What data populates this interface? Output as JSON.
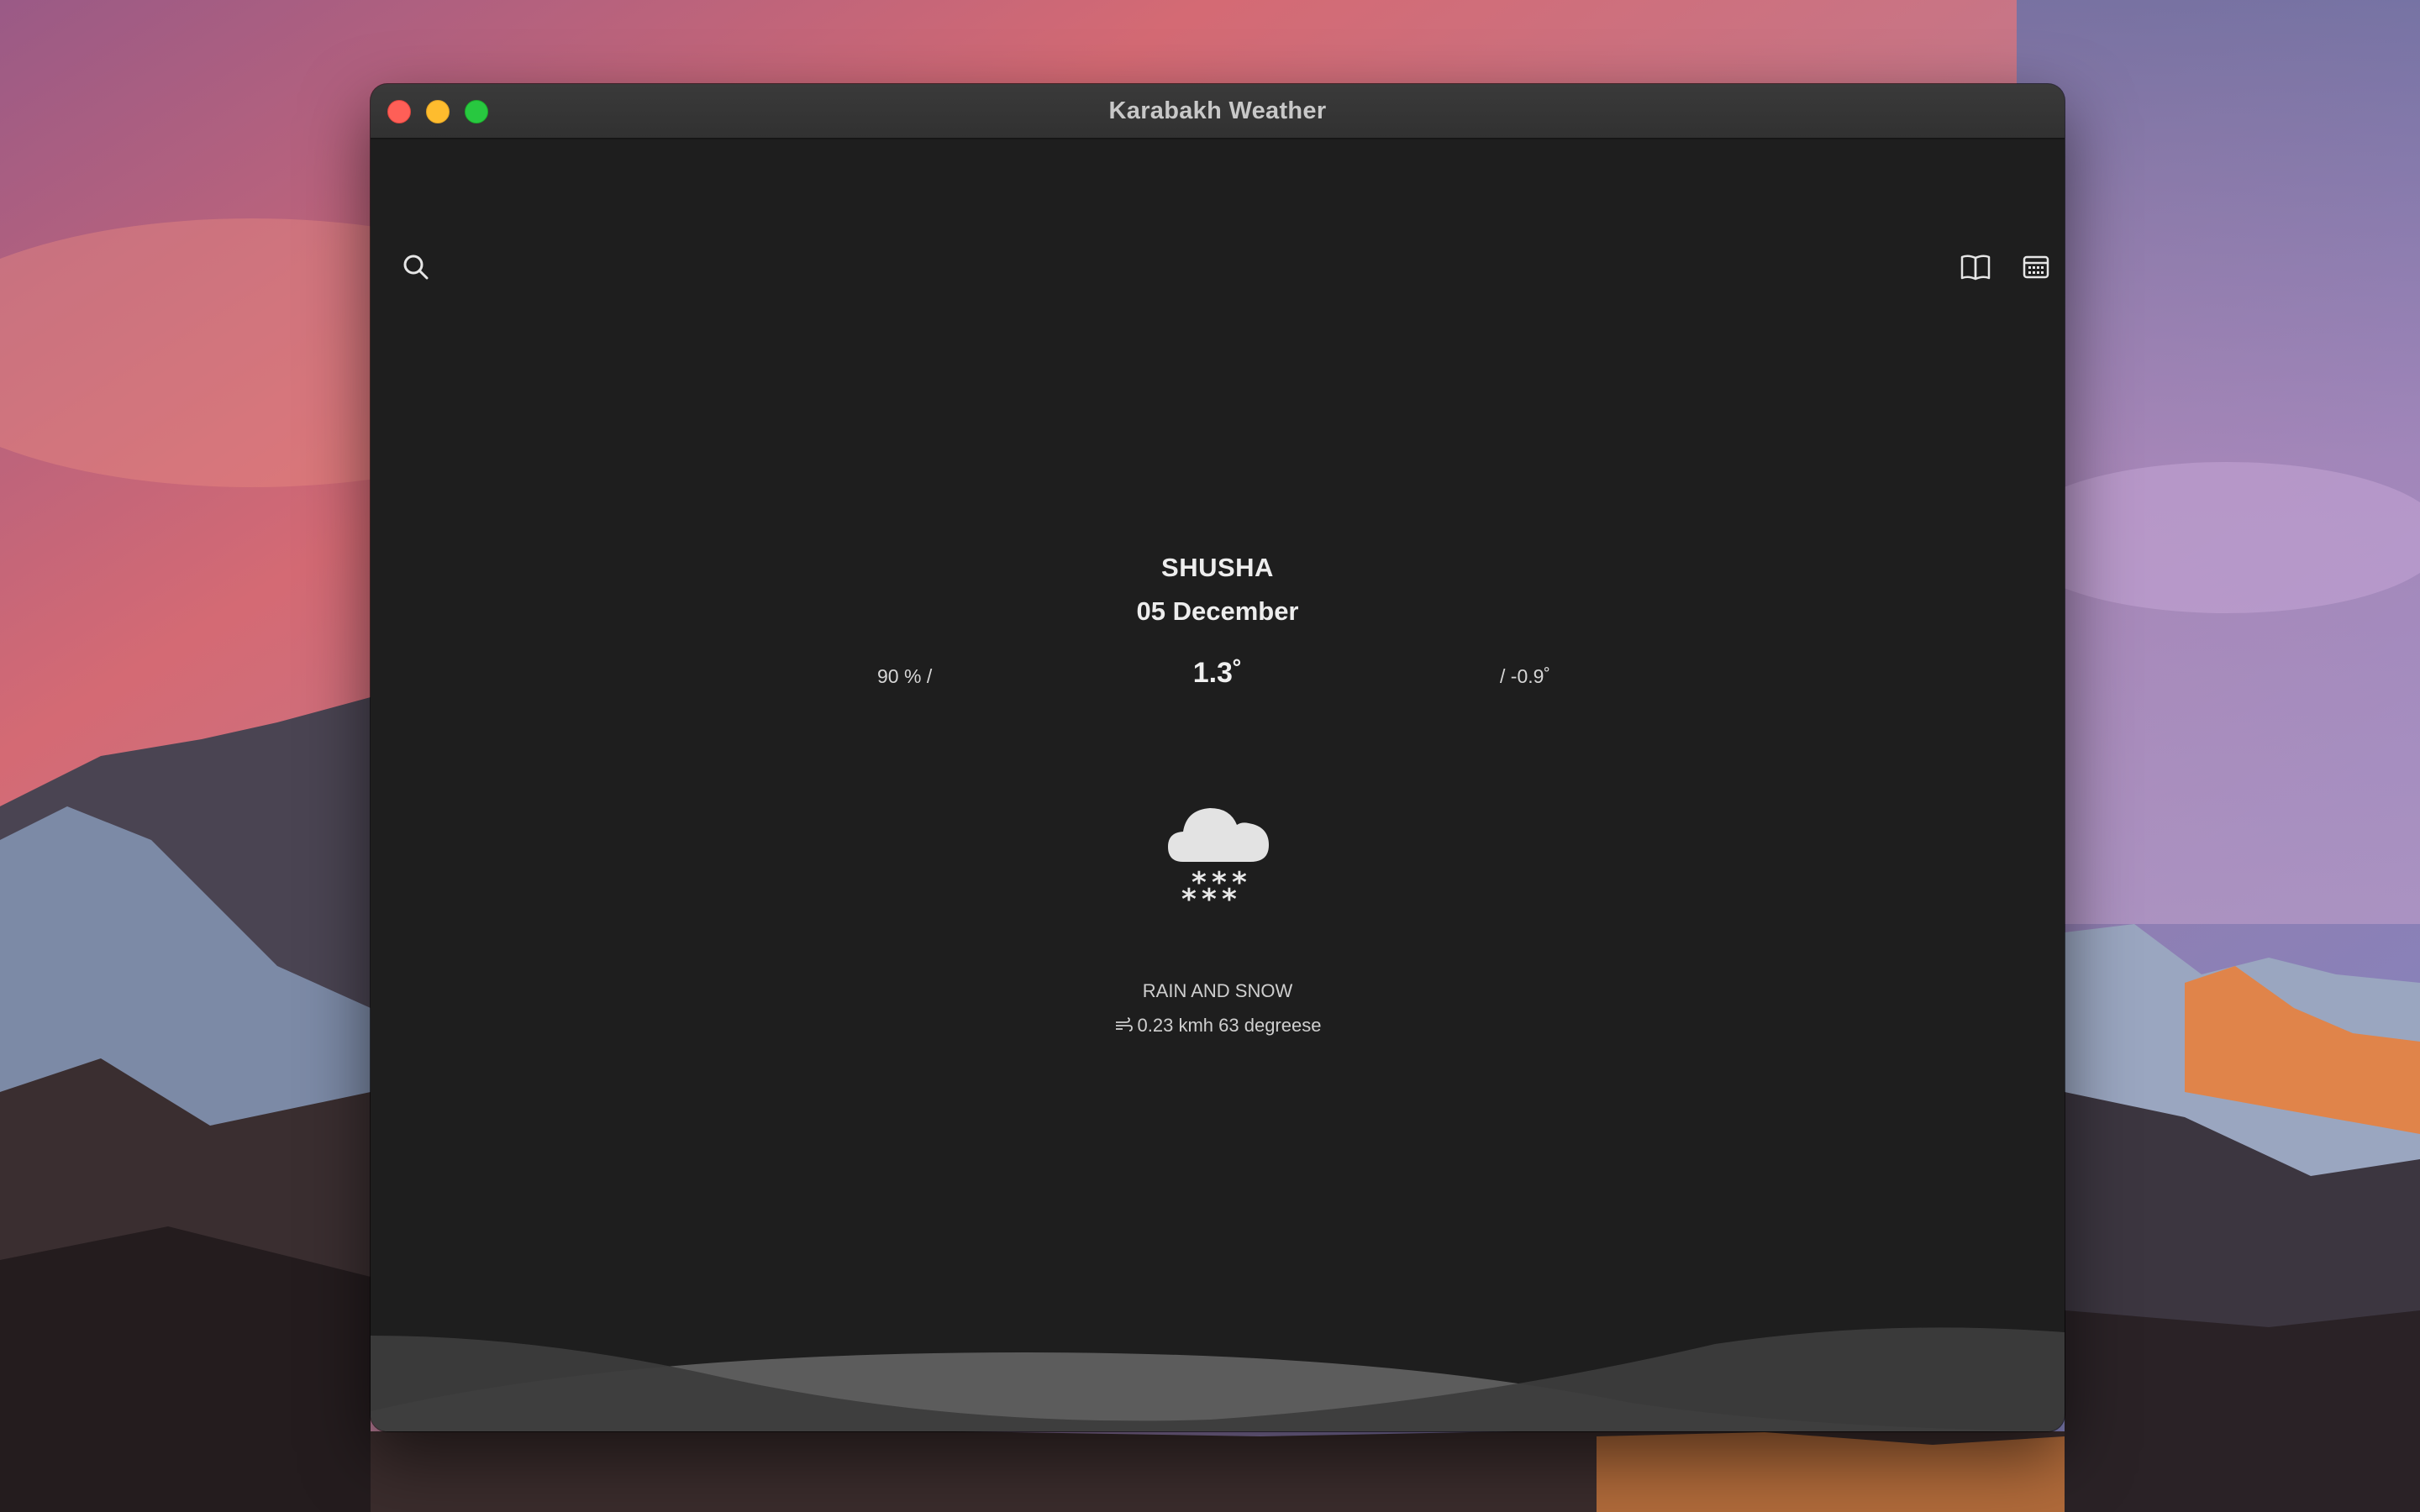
{
  "window": {
    "title": "Karabakh Weather"
  },
  "toolbar": {
    "search_icon": "search-icon",
    "book_icon": "book-icon",
    "calendar_icon": "calendar-icon"
  },
  "weather": {
    "city": "SHUSHA",
    "date": "05 December",
    "humidity": "90 % /",
    "temperature": "1.3˚",
    "low": "/ -0.9˚",
    "condition": "RAIN AND SNOW",
    "wind": "0.23 kmh 63 degreese",
    "icon": "cloud-snow-icon"
  },
  "colors": {
    "window_bg": "#1e1e1e",
    "titlebar": "#333333",
    "text": "#ededed",
    "wave_dark": "#3b3b3b",
    "wave_light": "#5a5a5a"
  }
}
